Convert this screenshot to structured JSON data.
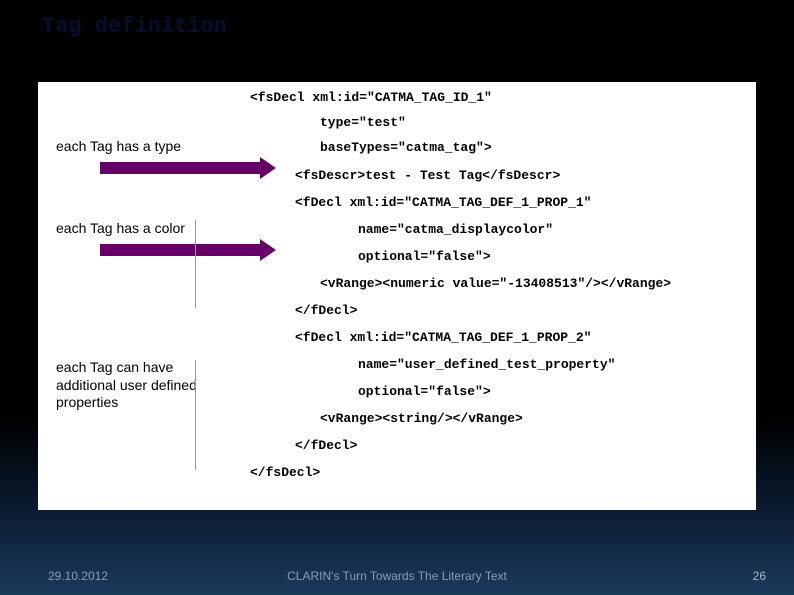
{
  "title": "Tag definition",
  "annotations": {
    "type_label": "each Tag has a type",
    "color_label": "each Tag has a color",
    "props_label": "each Tag can have additional user defined properties"
  },
  "code": {
    "l1": "<fsDecl xml:id=\"CATMA_TAG_ID_1\"",
    "l2": "type=\"test\"",
    "l3": "baseTypes=\"catma_tag\">",
    "l4": "<fsDescr>test - Test Tag</fsDescr>",
    "l5": "<fDecl xml:id=\"CATMA_TAG_DEF_1_PROP_1\"",
    "l6": "name=\"catma_displaycolor\"",
    "l7": "optional=\"false\">",
    "l8": "<vRange><numeric value=\"-13408513\"/></vRange>",
    "l9": "</fDecl>",
    "l10": "<fDecl xml:id=\"CATMA_TAG_DEF_1_PROP_2\"",
    "l11": "name=\"user_defined_test_property\"",
    "l12": "optional=\"false\">",
    "l13": "<vRange><string/></vRange>",
    "l14": "</fDecl>",
    "l15": "</fsDecl>"
  },
  "footer": {
    "date": "29.10.2012",
    "center": "CLARIN's Turn Towards The Literary Text",
    "page": "26"
  }
}
